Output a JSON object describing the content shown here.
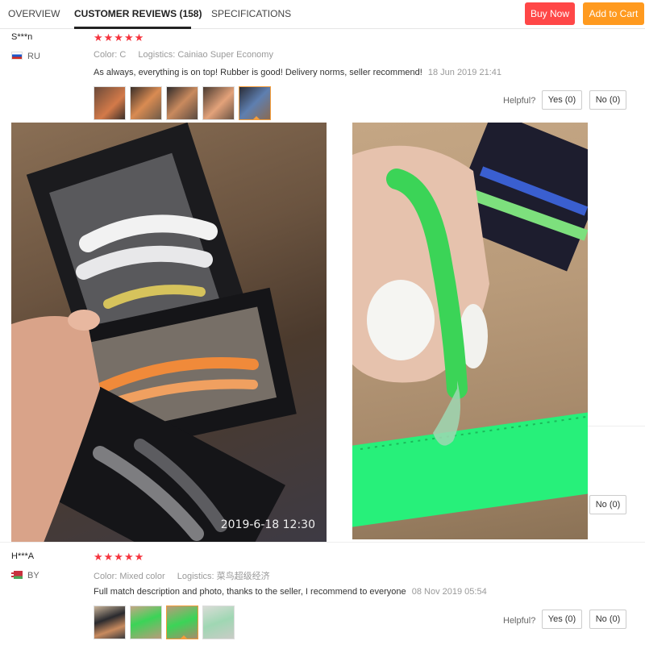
{
  "tabs": {
    "overview": "OVERVIEW",
    "reviews": "CUSTOMER REVIEWS (158)",
    "specifications": "SPECIFICATIONS"
  },
  "actions": {
    "buy_now": "Buy Now",
    "add_to_cart": "Add to Cart",
    "buy_color": "#ff4747",
    "cart_color": "#ff9a1f"
  },
  "reviews": [
    {
      "user": "S***n",
      "country": "RU",
      "stars": "★★★★★",
      "color_label": "Color:",
      "color_value": "C",
      "logistics_label": "Logistics:",
      "logistics_value": "Cainiao Super Economy",
      "text": "As always, everything is on top! Rubber is good! Delivery norms, seller recommend!",
      "date": "18 Jun 2019 21:41",
      "helpful_label": "Helpful?",
      "yes_label": "Yes (0)",
      "no_label": "No (0)",
      "photo_timestamp": "2019-6-18  12:30"
    },
    {
      "user": "H***A",
      "country": "BY",
      "stars": "★★★★★",
      "color_label": "Color:",
      "color_value": "Mixed color",
      "logistics_label": "Logistics:",
      "logistics_value": "菜鸟超级经济",
      "text": "Full match description and photo, thanks to the seller, I recommend to everyone",
      "date": "08 Nov 2019 05:54",
      "helpful_label": "Helpful?",
      "yes_label": "Yes (0)",
      "no_label": "No (0)"
    }
  ],
  "middle_no_label": "No (0)",
  "star_color": "#f5343e"
}
